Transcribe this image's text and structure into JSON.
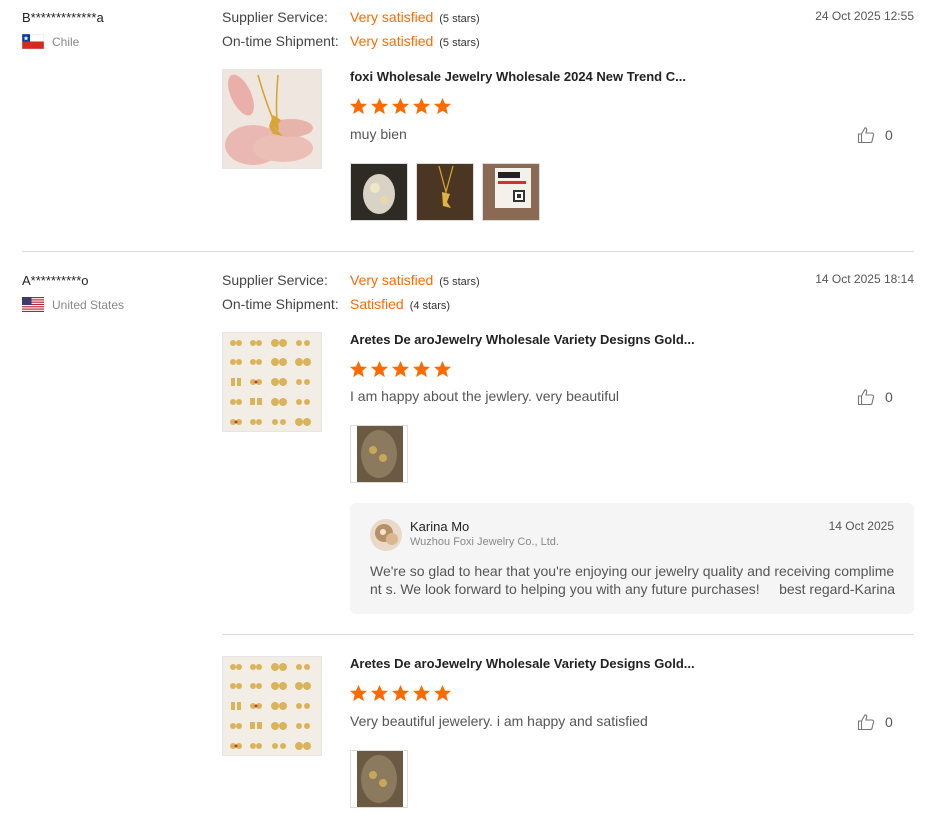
{
  "colors": {
    "accent": "#ff6a00",
    "star": "#ff6a00"
  },
  "reviews": [
    {
      "buyer": "B*************a",
      "country": "Chile",
      "supplier_label": "Supplier Service:",
      "supplier_rating": "Very satisfied",
      "supplier_stars": "(5 stars)",
      "shipment_label": "On-time Shipment:",
      "shipment_rating": "Very satisfied",
      "shipment_stars": "(5 stars)",
      "date": "24 Oct 2025 12:55",
      "product_title": "foxi Wholesale Jewelry Wholesale 2024 New Trend C...",
      "rating": 5,
      "text": "muy bien",
      "likes": "0"
    },
    {
      "buyer": "A**********o",
      "country": "United States",
      "supplier_label": "Supplier Service:",
      "supplier_rating": "Very satisfied",
      "supplier_stars": "(5 stars)",
      "shipment_label": "On-time Shipment:",
      "shipment_rating": "Satisfied",
      "shipment_stars": "(4 stars)",
      "date": "14 Oct 2025 18:14",
      "product_title": "Aretes De aroJewelry Wholesale Variety Designs Gold...",
      "rating": 5,
      "text": "I am happy about the jewlery. very beautiful",
      "likes": "0",
      "reply": {
        "name": "Karina Mo",
        "company": "Wuzhou Foxi Jewelry Co., Ltd.",
        "date": "14 Oct 2025",
        "text": "We're so glad to hear that you're enjoying our jewelry quality and receiving compliment s. We look forward to helping you with any future purchases!     best regard-Karina"
      }
    },
    {
      "product_title": "Aretes De aroJewelry Wholesale Variety Designs Gold...",
      "rating": 5,
      "text": "Very beautiful jewelery. i am happy and satisfied",
      "likes": "0"
    }
  ]
}
